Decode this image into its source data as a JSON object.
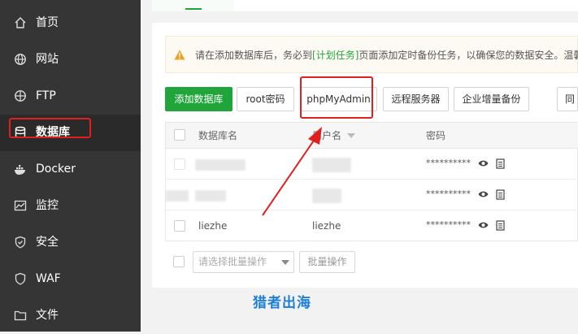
{
  "sidebar": {
    "items": [
      {
        "label": "首页",
        "icon": "home-icon"
      },
      {
        "label": "网站",
        "icon": "globe-icon"
      },
      {
        "label": "FTP",
        "icon": "ftp-icon"
      },
      {
        "label": "数据库",
        "icon": "database-icon",
        "active": true
      },
      {
        "label": "Docker",
        "icon": "docker-icon"
      },
      {
        "label": "监控",
        "icon": "monitor-icon"
      },
      {
        "label": "安全",
        "icon": "shield-icon"
      },
      {
        "label": "WAF",
        "icon": "waf-icon"
      },
      {
        "label": "文件",
        "icon": "folder-icon"
      }
    ]
  },
  "notice": {
    "before": "请在添加数据库后，务必到",
    "link": "[计划任务]",
    "after": "页面添加定时备份任务，以确保您的数据安全。温馨"
  },
  "toolbar": {
    "add_db": "添加数据库",
    "root_pwd": "root密码",
    "phpmyadmin": "phpMyAdmin",
    "remote_server": "远程服务器",
    "enterprise_backup": "企业增量备份",
    "sync": "同"
  },
  "table": {
    "headers": {
      "name": "数据库名",
      "user": "用户名",
      "password": "密码"
    },
    "rows": [
      {
        "name": "",
        "user": "",
        "password": "**********"
      },
      {
        "name": "",
        "user": "",
        "password": "**********"
      },
      {
        "name": "liezhe",
        "user": "liezhe",
        "password": "**********"
      }
    ]
  },
  "batch": {
    "select_placeholder": "请选择批量操作",
    "button": "批量操作"
  },
  "watermark": "猎者出海",
  "colors": {
    "sidebar_bg": "#353535",
    "accent": "#20a53a",
    "highlight": "#e02020",
    "watermark": "#1e7fd8"
  }
}
